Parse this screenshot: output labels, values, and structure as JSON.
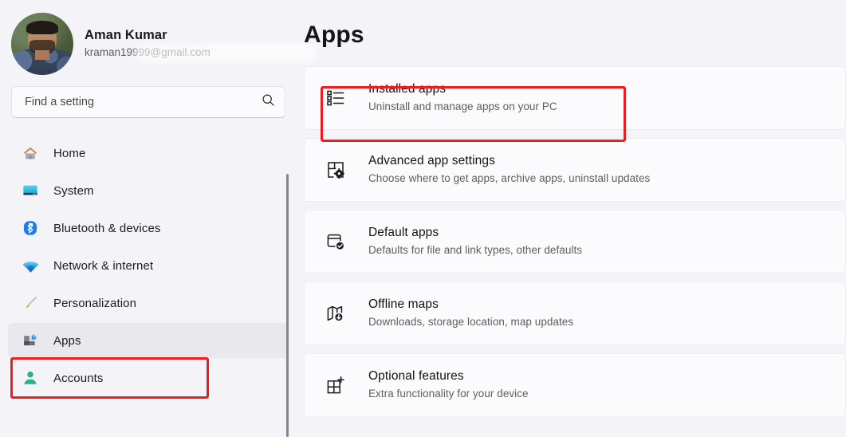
{
  "account": {
    "name": "Aman Kumar",
    "email": "kraman19999@gmail.com",
    "avatar_icon": "user-avatar-photo"
  },
  "search": {
    "placeholder": "Find a setting",
    "value": "",
    "icon": "search-icon"
  },
  "sidebar": {
    "items": [
      {
        "label": "Home",
        "icon": "home-icon",
        "selected": false
      },
      {
        "label": "System",
        "icon": "monitor-icon",
        "selected": false
      },
      {
        "label": "Bluetooth & devices",
        "icon": "bluetooth-icon",
        "selected": false
      },
      {
        "label": "Network & internet",
        "icon": "wifi-icon",
        "selected": false
      },
      {
        "label": "Personalization",
        "icon": "paintbrush-icon",
        "selected": false
      },
      {
        "label": "Apps",
        "icon": "apps-icon",
        "selected": true
      },
      {
        "label": "Accounts",
        "icon": "person-icon",
        "selected": false
      }
    ],
    "scrollbar": "vertical-scrollbar"
  },
  "main": {
    "title": "Apps",
    "cards": [
      {
        "title": "Installed apps",
        "subtitle": "Uninstall and manage apps on your PC",
        "icon": "list-bullets-icon",
        "highlighted": true
      },
      {
        "title": "Advanced app settings",
        "subtitle": "Choose where to get apps, archive apps, uninstall updates",
        "icon": "grid-gear-icon",
        "highlighted": false
      },
      {
        "title": "Default apps",
        "subtitle": "Defaults for file and link types, other defaults",
        "icon": "window-check-icon",
        "highlighted": false
      },
      {
        "title": "Offline maps",
        "subtitle": "Downloads, storage location, map updates",
        "icon": "map-download-icon",
        "highlighted": false
      },
      {
        "title": "Optional features",
        "subtitle": "Extra functionality for your device",
        "icon": "grid-plus-icon",
        "highlighted": false
      }
    ]
  },
  "annotations": {
    "highlight_color": "#f01c1c",
    "boxes": [
      {
        "name": "apps-sidebar-highlight"
      },
      {
        "name": "installed-apps-highlight"
      }
    ]
  },
  "colors": {
    "background": "#f3f3f8",
    "card": "#fbfbfd",
    "selected_row": "#e8e8ed",
    "accent_red": "#f01c1c",
    "text_primary": "#161616",
    "text_secondary": "#5e5e5e"
  }
}
